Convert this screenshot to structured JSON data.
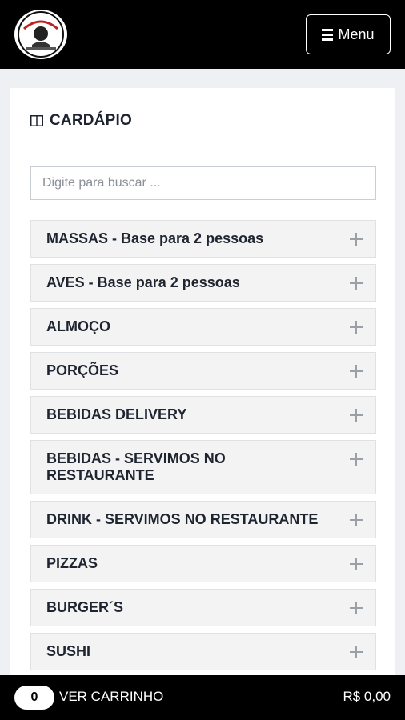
{
  "header": {
    "menu_label": "Menu"
  },
  "section": {
    "title": "CARDÁPIO"
  },
  "search": {
    "placeholder": "Digite para buscar ..."
  },
  "categories": [
    {
      "label": "MASSAS - Base para 2 pessoas"
    },
    {
      "label": "AVES - Base para 2 pessoas"
    },
    {
      "label": "ALMOÇO"
    },
    {
      "label": "PORÇÕES"
    },
    {
      "label": "BEBIDAS DELIVERY"
    },
    {
      "label": "BEBIDAS - SERVIMOS NO RESTAURANTE"
    },
    {
      "label": "DRINK - SERVIMOS NO RESTAURANTE"
    },
    {
      "label": "PIZZAS"
    },
    {
      "label": "BURGER´S"
    },
    {
      "label": "SUSHI"
    },
    {
      "label": ""
    }
  ],
  "cart": {
    "count": "0",
    "label": "VER CARRINHO",
    "total": "R$ 0,00"
  }
}
